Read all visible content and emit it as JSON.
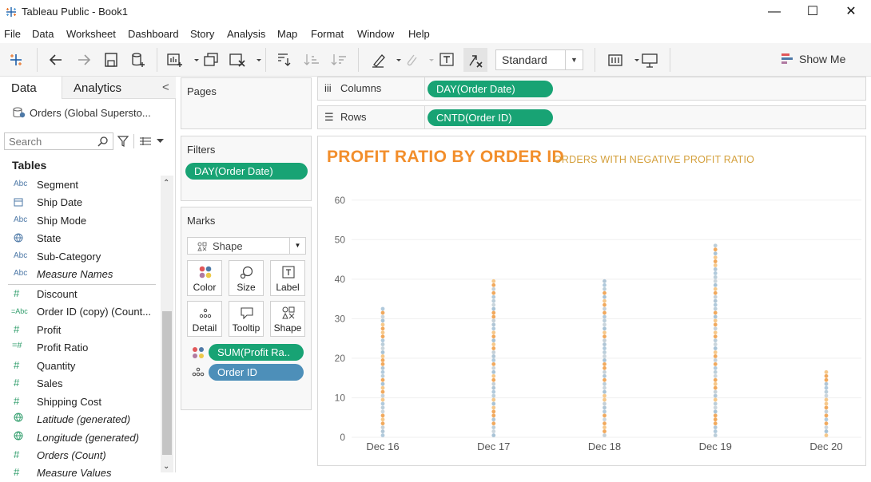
{
  "window": {
    "title": "Tableau Public - Book1",
    "minimize": "—",
    "maximize": "☐",
    "close": "✕"
  },
  "menu": [
    "File",
    "Data",
    "Worksheet",
    "Dashboard",
    "Story",
    "Analysis",
    "Map",
    "Format",
    "Window",
    "Help"
  ],
  "toolbar": {
    "fit_label": "Standard",
    "show_me_label": "Show Me"
  },
  "data_pane": {
    "tabs": [
      "Data",
      "Analytics"
    ],
    "collapse_glyph": "<",
    "datasource": "Orders (Global Supersto...",
    "search_placeholder": "Search",
    "tables_heading": "Tables",
    "dimensions": [
      {
        "type": "Abc",
        "label": "Segment"
      },
      {
        "type": "date",
        "label": "Ship Date"
      },
      {
        "type": "Abc",
        "label": "Ship Mode"
      },
      {
        "type": "geo",
        "label": "State"
      },
      {
        "type": "Abc",
        "label": "Sub-Category"
      },
      {
        "type": "Abc",
        "label": "Measure Names"
      }
    ],
    "measures": [
      {
        "type": "#",
        "label": "Discount"
      },
      {
        "type": "=Abc",
        "label": "Order ID (copy) (Count..."
      },
      {
        "type": "#",
        "label": "Profit"
      },
      {
        "type": "=#",
        "label": "Profit Ratio"
      },
      {
        "type": "#",
        "label": "Quantity"
      },
      {
        "type": "#",
        "label": "Sales"
      },
      {
        "type": "#",
        "label": "Shipping Cost"
      },
      {
        "type": "geo",
        "label": "Latitude (generated)"
      },
      {
        "type": "geo",
        "label": "Longitude (generated)"
      },
      {
        "type": "#",
        "label": "Orders (Count)"
      },
      {
        "type": "#",
        "label": "Measure Values"
      }
    ]
  },
  "pages_label": "Pages",
  "filters_label": "Filters",
  "filters_pill": "DAY(Order Date)",
  "marks": {
    "label": "Marks",
    "type": "Shape",
    "cards": [
      "Color",
      "Size",
      "Label",
      "Detail",
      "Tooltip",
      "Shape"
    ],
    "pills": [
      "SUM(Profit Ra..",
      "Order ID"
    ]
  },
  "columns": {
    "label": "Columns",
    "pill": "DAY(Order Date)"
  },
  "rows": {
    "label": "Rows",
    "pill": "CNTD(Order ID)"
  },
  "colors": {
    "pill_green": "#18a374",
    "pill_blue": "#4d8fb9",
    "title_orange": "#f28e2b",
    "subtitle_gold": "#d4a03c"
  },
  "chart_data": {
    "type": "scatter",
    "title": "PROFIT RATIO BY ORDER ID",
    "subtitle": "ORDERS WITH NEGATIVE PROFIT RATIO",
    "categories": [
      "Dec 16",
      "Dec 17",
      "Dec 18",
      "Dec 19",
      "Dec 20"
    ],
    "series": [
      {
        "values": [
          33,
          40,
          40,
          49,
          17
        ]
      }
    ],
    "ylim": [
      0,
      65
    ],
    "yticks": [
      0,
      10,
      20,
      30,
      40,
      50,
      60
    ],
    "grid": true
  }
}
